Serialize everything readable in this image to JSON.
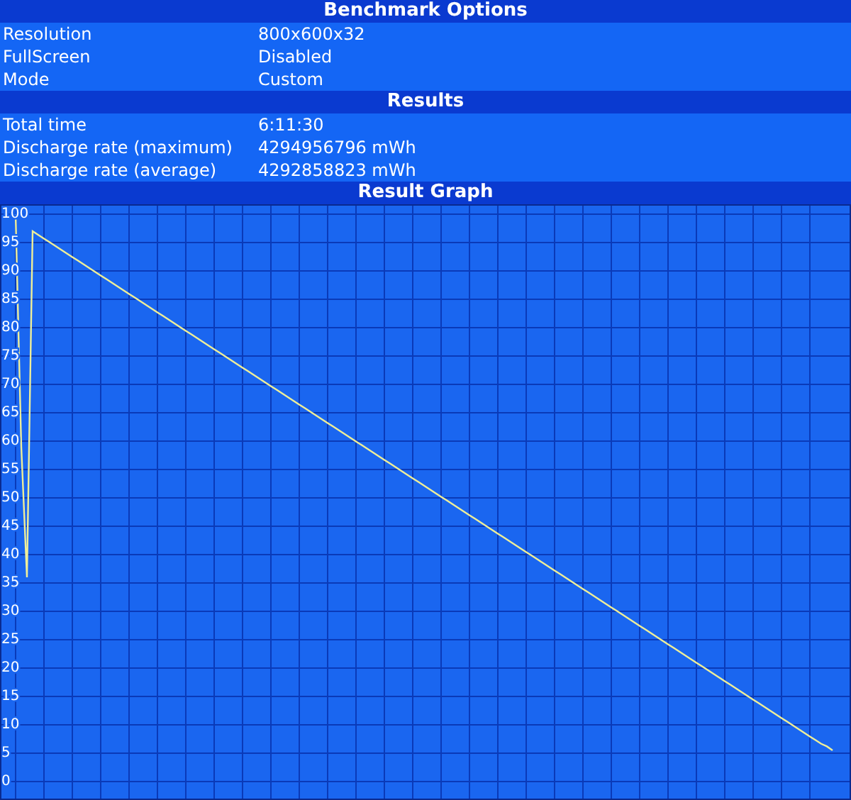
{
  "sections": [
    {
      "title": "Benchmark Options",
      "rows": [
        {
          "label": "Resolution",
          "value": "800x600x32"
        },
        {
          "label": "FullScreen",
          "value": "Disabled"
        },
        {
          "label": "Mode",
          "value": "Custom"
        }
      ]
    },
    {
      "title": "Results",
      "rows": [
        {
          "label": "Total time",
          "value": "6:11:30"
        },
        {
          "label": "Discharge rate (maximum)",
          "value": "4294956796 mWh"
        },
        {
          "label": "Discharge rate (average)",
          "value": "4292858823 mWh"
        }
      ]
    }
  ],
  "graph": {
    "title": "Result Graph",
    "chart_data": {
      "type": "line",
      "grid": true,
      "ylim": [
        0,
        100
      ],
      "yticks": [
        0,
        5,
        10,
        15,
        20,
        25,
        30,
        35,
        40,
        45,
        50,
        55,
        60,
        65,
        70,
        75,
        80,
        85,
        90,
        95,
        100
      ],
      "categories": [
        null,
        null,
        null,
        null,
        null,
        null,
        null,
        null,
        null,
        null,
        null,
        null,
        null,
        null,
        null,
        null,
        null,
        null,
        null,
        null,
        null,
        null,
        null,
        null,
        null,
        null,
        null,
        null,
        null,
        null,
        null,
        null,
        null,
        null,
        null,
        null,
        null,
        null,
        null,
        null,
        null,
        null,
        null,
        null,
        null,
        null,
        null,
        null,
        null,
        null,
        null,
        null,
        null,
        null,
        null,
        null,
        null,
        null,
        null,
        null,
        null,
        null,
        null,
        null,
        null,
        null,
        null,
        null,
        null,
        null,
        null,
        null,
        null,
        null,
        null,
        null,
        null,
        null,
        null,
        null,
        null,
        null,
        null,
        null,
        null,
        null,
        null,
        null,
        null,
        null,
        null,
        null,
        null,
        null,
        null,
        null,
        null,
        null,
        null,
        null,
        null,
        null,
        null,
        null,
        null,
        null,
        null,
        null,
        null,
        null,
        null,
        null,
        null,
        null,
        null,
        null,
        null,
        null,
        null,
        null,
        null,
        null,
        null,
        null,
        null,
        null,
        null,
        null,
        null,
        null,
        null,
        null,
        null,
        null,
        null,
        null,
        null,
        null,
        null,
        null,
        null,
        null,
        null,
        null,
        null
      ],
      "series": [
        {
          "color": "#eeee99",
          "values": [
            100,
            59,
            36,
            97,
            96.35,
            95.7,
            95.05,
            94.4,
            93.75,
            93.1,
            92.45,
            91.8,
            91.15,
            90.5,
            89.85,
            89.2,
            88.55,
            87.9,
            87.25,
            86.6,
            85.95,
            85.3,
            84.65,
            84,
            83.35,
            82.7,
            82.05,
            81.4,
            80.75,
            80.1,
            79.45,
            78.8,
            78.15,
            77.5,
            76.85,
            76.2,
            75.55,
            74.9,
            74.25,
            73.6,
            72.95,
            72.3,
            71.65,
            71,
            70.35,
            69.7,
            69.05,
            68.4,
            67.75,
            67.1,
            66.45,
            65.8,
            65.15,
            64.5,
            63.85,
            63.2,
            62.55,
            61.9,
            61.25,
            60.6,
            59.95,
            59.3,
            58.65,
            58,
            57.35,
            56.7,
            56.05,
            55.4,
            54.75,
            54.1,
            53.45,
            52.8,
            52.15,
            51.5,
            50.85,
            50.2,
            49.55,
            48.9,
            48.25,
            47.6,
            46.95,
            46.3,
            45.65,
            45,
            44.35,
            43.7,
            43.05,
            42.4,
            41.75,
            41.1,
            40.45,
            39.8,
            39.15,
            38.5,
            37.85,
            37.2,
            36.55,
            35.9,
            35.25,
            34.6,
            33.95,
            33.3,
            32.65,
            32,
            31.35,
            30.7,
            30.05,
            29.4,
            28.75,
            28.1,
            27.45,
            26.8,
            26.15,
            25.5,
            24.85,
            24.2,
            23.55,
            22.9,
            22.25,
            21.6,
            20.95,
            20.3,
            19.65,
            19,
            18.35,
            17.7,
            17.05,
            16.4,
            15.75,
            15.1,
            14.45,
            13.8,
            13.15,
            12.5,
            11.85,
            11.2,
            10.55,
            9.9,
            9.25,
            8.6,
            7.95,
            7.3,
            6.65,
            6.2,
            5.5
          ]
        }
      ]
    }
  }
}
